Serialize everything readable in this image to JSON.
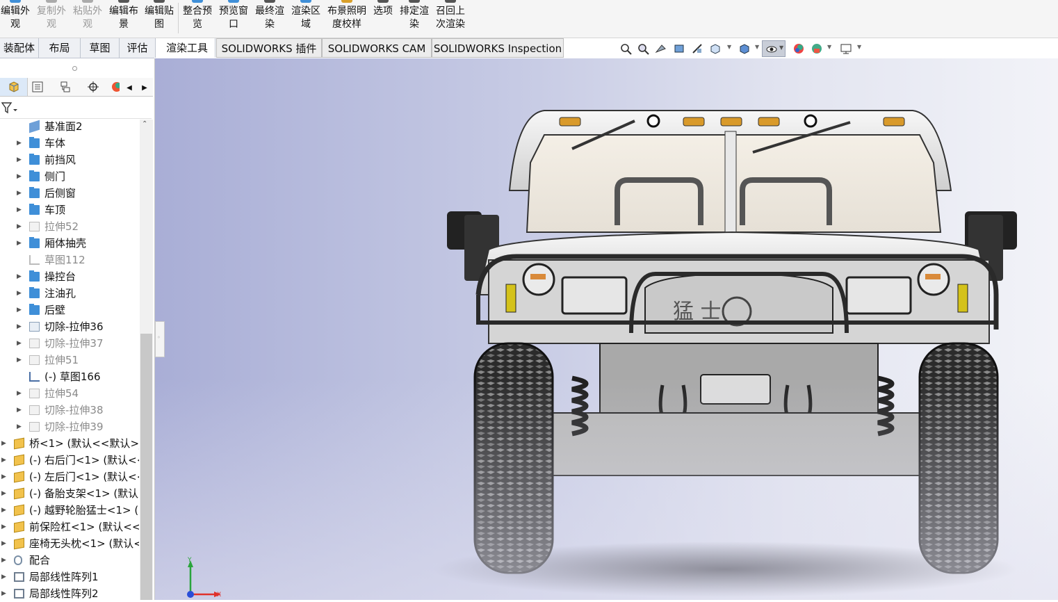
{
  "ribbon": {
    "buttons": [
      {
        "label": "编辑外\n观",
        "enabled": true
      },
      {
        "label": "复制外\n观",
        "enabled": false
      },
      {
        "label": "粘贴外\n观",
        "enabled": false
      },
      {
        "label": "编辑布\n景",
        "enabled": true
      },
      {
        "label": "编辑贴\n图",
        "enabled": true
      },
      {
        "label": "整合预\n览",
        "enabled": true
      },
      {
        "label": "预览窗\n口",
        "enabled": true
      },
      {
        "label": "最终渲\n染",
        "enabled": true
      },
      {
        "label": "渲染区\n域",
        "enabled": true
      },
      {
        "label": "布景照明\n度校样",
        "enabled": true
      },
      {
        "label": "选项",
        "enabled": true
      },
      {
        "label": "排定渲\n染",
        "enabled": true
      },
      {
        "label": "召回上\n次渲染",
        "enabled": true
      }
    ]
  },
  "tabs": [
    {
      "label": "装配体"
    },
    {
      "label": "布局"
    },
    {
      "label": "草图"
    },
    {
      "label": "评估"
    },
    {
      "label": "渲染工具",
      "active": true
    },
    {
      "label": "SOLIDWORKS 插件"
    },
    {
      "label": "SOLIDWORKS CAM"
    },
    {
      "label": "SOLIDWORKS Inspection"
    }
  ],
  "feature_tree": {
    "items": [
      {
        "label": "基准面2",
        "icon": "plane-icon",
        "expandable": false,
        "dim": false,
        "level": 1
      },
      {
        "label": "车体",
        "icon": "folder-icon",
        "expandable": true,
        "dim": false,
        "level": 1
      },
      {
        "label": "前挡风",
        "icon": "folder-icon",
        "expandable": true,
        "dim": false,
        "level": 1
      },
      {
        "label": "侧门",
        "icon": "folder-icon",
        "expandable": true,
        "dim": false,
        "level": 1
      },
      {
        "label": "后侧窗",
        "icon": "folder-icon",
        "expandable": true,
        "dim": false,
        "level": 1
      },
      {
        "label": "车顶",
        "icon": "folder-icon",
        "expandable": true,
        "dim": false,
        "level": 1
      },
      {
        "label": "拉伸52",
        "icon": "extrude-icon",
        "expandable": true,
        "dim": true,
        "level": 1
      },
      {
        "label": "厢体抽壳",
        "icon": "folder-icon",
        "expandable": true,
        "dim": false,
        "level": 1
      },
      {
        "label": "草图112",
        "icon": "sketch-icon",
        "expandable": false,
        "dim": true,
        "level": 1
      },
      {
        "label": "操控台",
        "icon": "folder-icon",
        "expandable": true,
        "dim": false,
        "level": 1
      },
      {
        "label": "注油孔",
        "icon": "folder-icon",
        "expandable": true,
        "dim": false,
        "level": 1
      },
      {
        "label": "后壁",
        "icon": "folder-icon",
        "expandable": true,
        "dim": false,
        "level": 1
      },
      {
        "label": "切除-拉伸36",
        "icon": "cut-extrude-icon",
        "expandable": true,
        "dim": false,
        "level": 1
      },
      {
        "label": "切除-拉伸37",
        "icon": "cut-extrude-icon",
        "expandable": true,
        "dim": true,
        "level": 1
      },
      {
        "label": "拉伸51",
        "icon": "extrude-icon",
        "expandable": true,
        "dim": true,
        "level": 1
      },
      {
        "label": "(-) 草图166",
        "icon": "sketch-icon",
        "expandable": false,
        "dim": false,
        "level": 1
      },
      {
        "label": "拉伸54",
        "icon": "extrude-icon",
        "expandable": true,
        "dim": true,
        "level": 1
      },
      {
        "label": "切除-拉伸38",
        "icon": "cut-extrude-icon",
        "expandable": true,
        "dim": true,
        "level": 1
      },
      {
        "label": "切除-拉伸39",
        "icon": "cut-extrude-icon",
        "expandable": true,
        "dim": true,
        "level": 1
      },
      {
        "label": "桥<1> (默认<<默认>_",
        "icon": "part-icon",
        "expandable": true,
        "dim": false,
        "level": 0
      },
      {
        "label": "(-) 右后门<1> (默认<<",
        "icon": "part-icon",
        "expandable": true,
        "dim": false,
        "level": 0
      },
      {
        "label": "(-) 左后门<1> (默认<<",
        "icon": "part-icon",
        "expandable": true,
        "dim": false,
        "level": 0
      },
      {
        "label": "(-) 备胎支架<1> (默认<",
        "icon": "part-icon",
        "expandable": true,
        "dim": false,
        "level": 0
      },
      {
        "label": "(-) 越野轮胎猛士<1> (D",
        "icon": "part-icon",
        "expandable": true,
        "dim": false,
        "level": 0
      },
      {
        "label": "前保险杠<1> (默认<<默",
        "icon": "part-icon",
        "expandable": true,
        "dim": false,
        "level": 0
      },
      {
        "label": "座椅无头枕<1> (默认<",
        "icon": "part-icon",
        "expandable": true,
        "dim": false,
        "level": 0
      },
      {
        "label": "配合",
        "icon": "mates-icon",
        "expandable": true,
        "dim": false,
        "level": 0
      },
      {
        "label": "局部线性阵列1",
        "icon": "linear-pattern-icon",
        "expandable": true,
        "dim": false,
        "level": 0
      },
      {
        "label": "局部线性阵列2",
        "icon": "linear-pattern-icon",
        "expandable": true,
        "dim": false,
        "level": 0
      }
    ]
  },
  "viewport": {
    "model_text": "猛 士",
    "triad": {
      "x_label": "X",
      "y_label": "Y"
    },
    "colors": {
      "x_axis": "#e0302a",
      "y_axis": "#2aa43c",
      "z_axis": "#2a4ed8"
    }
  },
  "view_toolbar": {
    "icons": [
      "zoom-to-fit-icon",
      "zoom-to-area-icon",
      "previous-view-icon",
      "section-view-icon",
      "dynamic-annotation-icon",
      "view-orientation-icon",
      "display-style-icon",
      "hide-show-items-icon",
      "edit-appearance-icon",
      "apply-scene-icon",
      "view-settings-icon"
    ]
  }
}
